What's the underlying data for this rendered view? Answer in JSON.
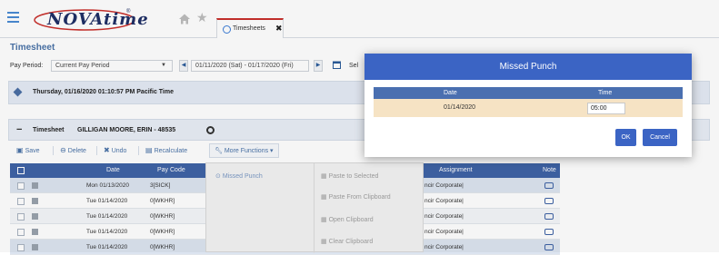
{
  "app": {
    "logo_text": "NOVAtime",
    "logo_mark": "®"
  },
  "tabs": [
    {
      "label": "Timesheets"
    }
  ],
  "page": {
    "title": "Timesheet",
    "pay_period_label": "Pay Period:",
    "pay_period_value": "Current Pay Period",
    "date_range": "01/11/2020 (Sat) - 01/17/2020 (Fri)",
    "select_label": "Sel"
  },
  "timestamp": "Thursday, 01/16/2020 01:10:57 PM Pacific Time",
  "timesheet_header": {
    "label": "Timesheet",
    "employee": "GILLIGAN MOORE, ERIN - 48535"
  },
  "toolbar": {
    "save": "Save",
    "delete": "Delete",
    "undo": "Undo",
    "recalculate": "Recalculate",
    "more_functions": "More Functions"
  },
  "grid": {
    "columns": [
      "Date",
      "Pay Code",
      "Assignment",
      "Note"
    ],
    "rows": [
      {
        "date": "Mon 01/13/2020",
        "pay_code": "3[SICK]",
        "assignment": "ncir Corporate|"
      },
      {
        "date": "Tue 01/14/2020",
        "pay_code": "0[WKHR]",
        "assignment": "ncir Corporate|"
      },
      {
        "date": "Tue 01/14/2020",
        "pay_code": "0[WKHR]",
        "assignment": "ncir Corporate|"
      },
      {
        "date": "Tue 01/14/2020",
        "pay_code": "0[WKHR]",
        "assignment": "ncir Corporate|"
      },
      {
        "date": "Tue 01/14/2020",
        "pay_code": "0[WKHR]",
        "assignment": "ncir Corporate|"
      }
    ]
  },
  "dropdown": {
    "left": [
      "Missed Punch"
    ],
    "right": [
      "Paste to Selected",
      "Paste From Clipboard",
      "Open Clipboard",
      "Clear Clipboard"
    ]
  },
  "modal": {
    "title": "Missed Punch",
    "col_date": "Date",
    "col_time": "Time",
    "row_date": "01/14/2020",
    "row_time": "05:00",
    "ok": "OK",
    "cancel": "Cancel"
  }
}
